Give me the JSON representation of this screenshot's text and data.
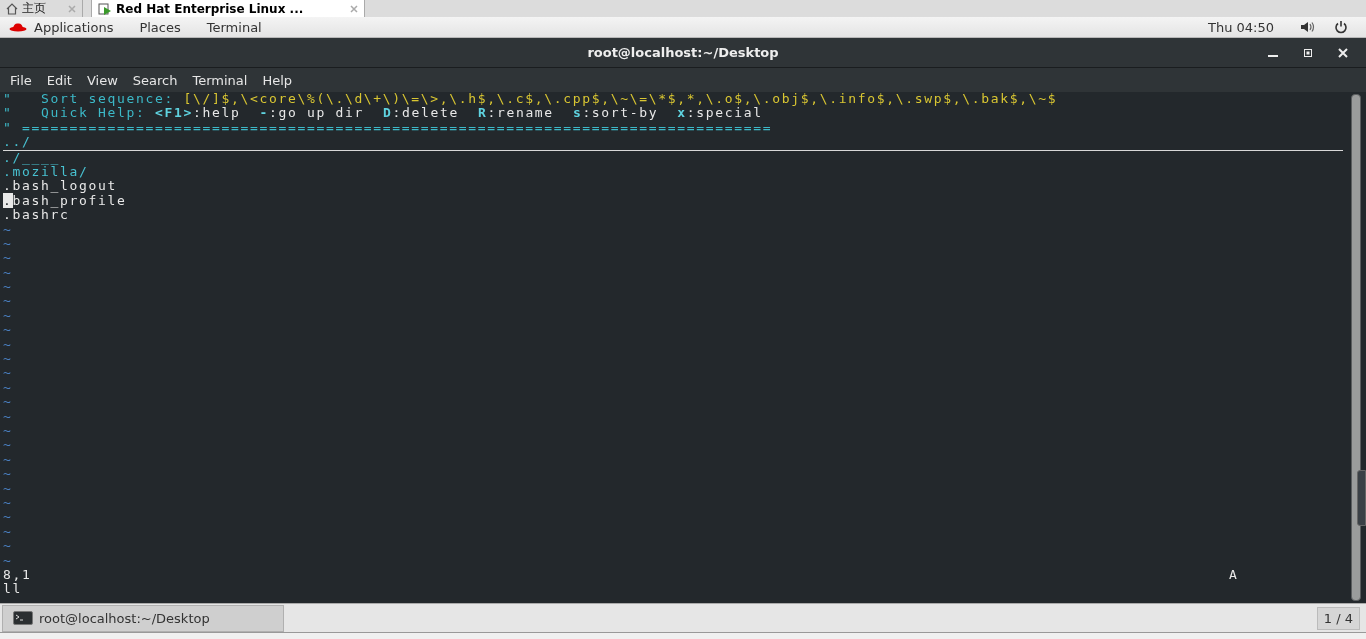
{
  "browser_tabs": [
    {
      "label": "主页",
      "selected": false,
      "kind": "home"
    },
    {
      "label": "Red Hat Enterprise Linux ...",
      "selected": true,
      "kind": "vm"
    }
  ],
  "top_bar": {
    "menus": [
      "Applications",
      "Places",
      "Terminal"
    ],
    "clock": "Thu 04:50"
  },
  "terminal": {
    "title": "root@localhost:~/Desktop",
    "menu": [
      "File",
      "Edit",
      "View",
      "Search",
      "Terminal",
      "Help"
    ],
    "banner": [
      [
        {
          "text": "\"   Sort sequence: ",
          "kind": "label"
        },
        {
          "text": "[\\/]$,\\<core\\%(\\.\\d\\+\\)\\=\\>,\\.h$,\\.c$,\\.cpp$,\\~\\=\\*$,*,\\.o$,\\.obj$,\\.info$,\\.swp$,\\.bak$,\\~$",
          "kind": "value"
        }
      ],
      [
        {
          "text": "\"   Quick Help: ",
          "kind": "label"
        },
        {
          "text": "<F1>",
          "kind": "key"
        },
        {
          "text": ":help  ",
          "kind": "plain"
        },
        {
          "text": "-",
          "kind": "key"
        },
        {
          "text": ":go up dir  ",
          "kind": "plain"
        },
        {
          "text": "D",
          "kind": "key"
        },
        {
          "text": ":delete  ",
          "kind": "plain"
        },
        {
          "text": "R",
          "kind": "key"
        },
        {
          "text": ":rename  ",
          "kind": "plain"
        },
        {
          "text": "s",
          "kind": "key"
        },
        {
          "text": ":sort-by  ",
          "kind": "plain"
        },
        {
          "text": "x",
          "kind": "key"
        },
        {
          "text": ":special",
          "kind": "plain"
        }
      ],
      [
        {
          "text": "\" ===============================================================================",
          "kind": "label"
        }
      ]
    ],
    "entries": [
      {
        "text": "../",
        "kind": "dir",
        "cursor": false,
        "underlined": true
      },
      {
        "text": "./____",
        "kind": "dir",
        "cursor": false,
        "underlined": false
      },
      {
        "text": ".mozilla/",
        "kind": "dir",
        "cursor": false,
        "underlined": false
      },
      {
        "text": ".bash_logout",
        "kind": "file",
        "cursor": false,
        "underlined": false
      },
      {
        "text": ".bash_profile",
        "kind": "file",
        "cursor": true,
        "underlined": false
      },
      {
        "text": ".bashrc",
        "kind": "file",
        "cursor": false,
        "underlined": false
      }
    ],
    "filler": [
      "~",
      "~",
      "~",
      "~",
      "~",
      "~",
      "~",
      "~",
      "~",
      "~",
      "~",
      "~",
      "~",
      "~",
      "~",
      "~",
      "~",
      "~",
      "~",
      "~",
      "~",
      "~",
      "~",
      "~"
    ],
    "ruler": "8,1",
    "scroll_position": "A",
    "command_line": "ll"
  },
  "taskbar": {
    "windows": [
      {
        "label": "root@localhost:~/Desktop",
        "selected": true
      }
    ],
    "pager": "1 / 4"
  }
}
